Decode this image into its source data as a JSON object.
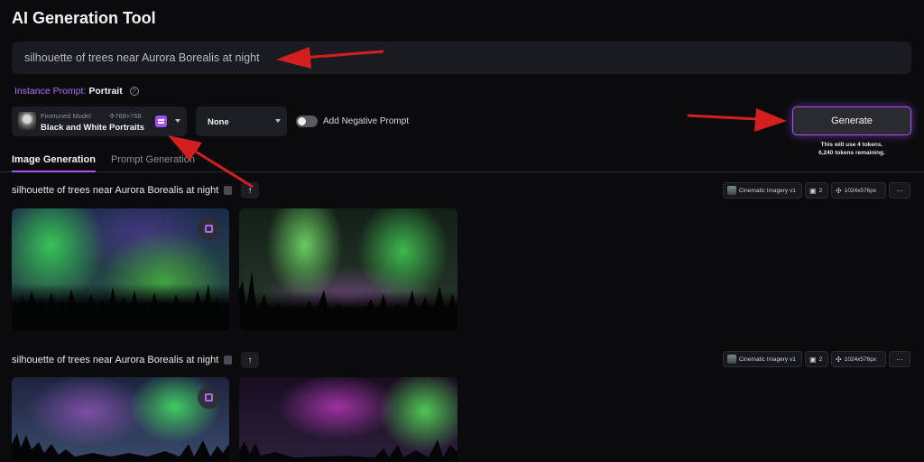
{
  "app": {
    "title": "AI Generation Tool"
  },
  "prompt": {
    "value": "silhouette of trees near Aurora Borealis at night"
  },
  "instance_prompt": {
    "label": "Instance Prompt:",
    "value": "Portrait",
    "help_icon": "help-icon"
  },
  "model": {
    "sub_label": "Finetuned Model",
    "size": "✣768×768",
    "name": "Black and White Portraits"
  },
  "style": {
    "value": "None"
  },
  "negative_prompt": {
    "label": "Add Negative Prompt",
    "enabled": false
  },
  "generate": {
    "label": "Generate",
    "note_line1": "This will use 4 tokens.",
    "note_line2": "6,240 tokens remaining."
  },
  "tabs": [
    {
      "label": "Image Generation",
      "active": true
    },
    {
      "label": "Prompt Generation",
      "active": false
    }
  ],
  "groups": [
    {
      "title": "silhouette of trees near Aurora Borealis at night",
      "style_chip": "Cinematic Imagery v1",
      "count": "2",
      "dims": "1024x576px",
      "more": "···"
    },
    {
      "title": "silhouette of trees near Aurora Borealis at night",
      "style_chip": "Cinematic Imagery v1",
      "count": "2",
      "dims": "1024x576px",
      "more": "···"
    }
  ],
  "colors": {
    "accent": "#a855f7",
    "annotation_arrow": "#d3201f"
  }
}
